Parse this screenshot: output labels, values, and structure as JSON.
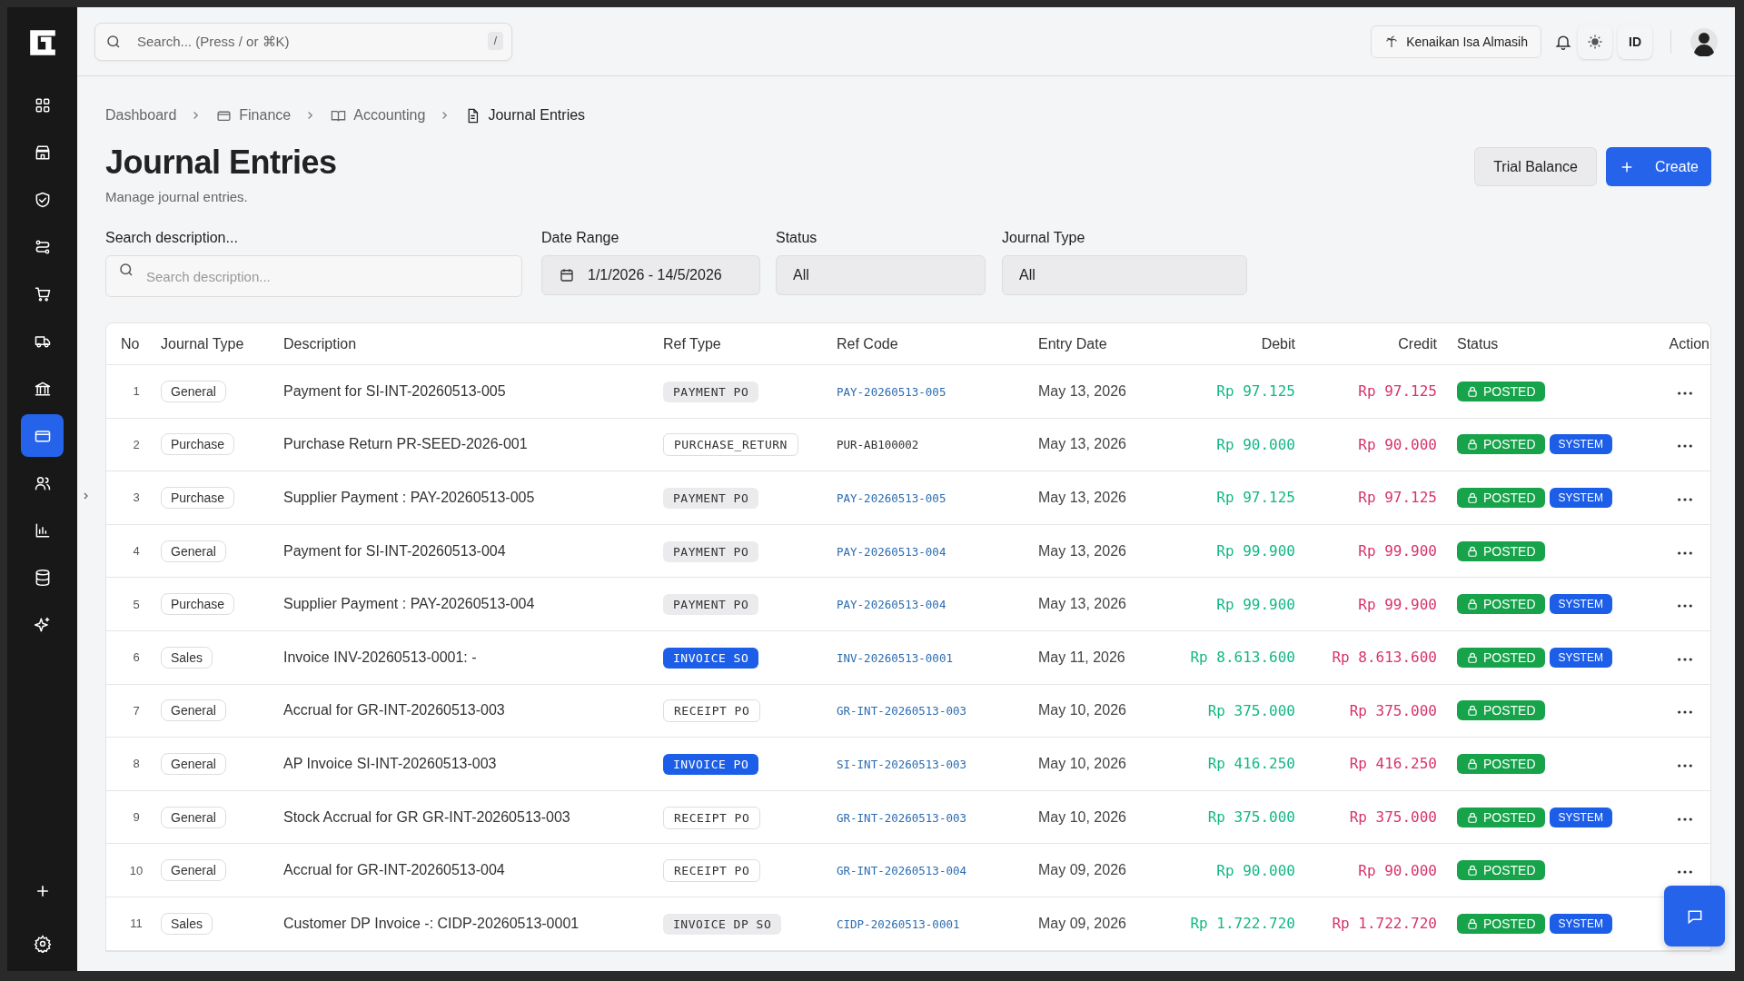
{
  "sidebar": {
    "items": [
      {
        "selected": false
      },
      {
        "selected": false
      },
      {
        "selected": false
      },
      {
        "selected": false
      },
      {
        "selected": false
      },
      {
        "selected": false
      },
      {
        "selected": false
      },
      {
        "selected": true
      },
      {
        "selected": false
      },
      {
        "selected": false
      },
      {
        "selected": false
      },
      {
        "selected": false
      }
    ]
  },
  "topbar": {
    "search": {
      "placeholder": "Search... (Press / or ⌘K)",
      "shortcut": "/"
    },
    "holiday": "Kenaikan Isa Almasih",
    "language": "ID"
  },
  "breadcrumb": [
    "Dashboard",
    "Finance",
    "Accounting",
    "Journal Entries"
  ],
  "page": {
    "title": "Journal Entries",
    "subtitle": "Manage journal entries.",
    "buttons": {
      "secondary": "Trial Balance",
      "primary": "Create"
    }
  },
  "filters": {
    "search": {
      "label": "Search description...",
      "placeholder": "Search description..."
    },
    "date_range": {
      "label": "Date Range",
      "value": "1/1/2026 - 14/5/2026"
    },
    "status": {
      "label": "Status",
      "value": "All"
    },
    "journal_type": {
      "label": "Journal Type",
      "value": "All"
    }
  },
  "table": {
    "columns": [
      "No",
      "Journal Type",
      "Description",
      "Ref Type",
      "Ref Code",
      "Entry Date",
      "Debit",
      "Credit",
      "Status",
      "Action"
    ],
    "rows": [
      {
        "no": "1",
        "journal_type": "General",
        "description": "Payment for SI-INT-20260513-005",
        "ref_type": {
          "label": "PAYMENT PO",
          "kind": "soft"
        },
        "ref_code": "PAY-20260513-005",
        "linked": true,
        "entry_date": "May 13, 2026",
        "debit": "Rp 97.125",
        "credit": "Rp 97.125",
        "status": "POSTED",
        "system": null,
        "menu": true
      },
      {
        "no": "2",
        "journal_type": "Purchase",
        "description": "Purchase Return PR-SEED-2026-001",
        "ref_type": {
          "label": "PURCHASE_RETURN",
          "kind": "outline"
        },
        "ref_code": "PUR-AB100002",
        "linked": false,
        "entry_date": "May 13, 2026",
        "debit": "Rp 90.000",
        "credit": "Rp 90.000",
        "status": "POSTED",
        "system": "SYSTEM",
        "menu": true
      },
      {
        "no": "3",
        "journal_type": "Purchase",
        "description": "Supplier Payment : PAY-20260513-005",
        "ref_type": {
          "label": "PAYMENT PO",
          "kind": "soft"
        },
        "ref_code": "PAY-20260513-005",
        "linked": true,
        "entry_date": "May 13, 2026",
        "debit": "Rp 97.125",
        "credit": "Rp 97.125",
        "status": "POSTED",
        "system": "SYSTEM",
        "menu": true
      },
      {
        "no": "4",
        "journal_type": "General",
        "description": "Payment for SI-INT-20260513-004",
        "ref_type": {
          "label": "PAYMENT PO",
          "kind": "soft"
        },
        "ref_code": "PAY-20260513-004",
        "linked": true,
        "entry_date": "May 13, 2026",
        "debit": "Rp 99.900",
        "credit": "Rp 99.900",
        "status": "POSTED",
        "system": null,
        "menu": true
      },
      {
        "no": "5",
        "journal_type": "Purchase",
        "description": "Supplier Payment : PAY-20260513-004",
        "ref_type": {
          "label": "PAYMENT PO",
          "kind": "soft"
        },
        "ref_code": "PAY-20260513-004",
        "linked": true,
        "entry_date": "May 13, 2026",
        "debit": "Rp 99.900",
        "credit": "Rp 99.900",
        "status": "POSTED",
        "system": "SYSTEM",
        "menu": true
      },
      {
        "no": "6",
        "journal_type": "Sales",
        "description": "Invoice INV-20260513-0001: -",
        "ref_type": {
          "label": "INVOICE SO",
          "kind": "solid"
        },
        "ref_code": "INV-20260513-0001",
        "linked": true,
        "entry_date": "May 11, 2026",
        "debit": "Rp 8.613.600",
        "credit": "Rp 8.613.600",
        "status": "POSTED",
        "system": "SYSTEM",
        "menu": true
      },
      {
        "no": "7",
        "journal_type": "General",
        "description": "Accrual for GR-INT-20260513-003",
        "ref_type": {
          "label": "RECEIPT PO",
          "kind": "outline"
        },
        "ref_code": "GR-INT-20260513-003",
        "linked": true,
        "entry_date": "May 10, 2026",
        "debit": "Rp 375.000",
        "credit": "Rp 375.000",
        "status": "POSTED",
        "system": null,
        "menu": true
      },
      {
        "no": "8",
        "journal_type": "General",
        "description": "AP Invoice SI-INT-20260513-003",
        "ref_type": {
          "label": "INVOICE PO",
          "kind": "solid"
        },
        "ref_code": "SI-INT-20260513-003",
        "linked": true,
        "entry_date": "May 10, 2026",
        "debit": "Rp 416.250",
        "credit": "Rp 416.250",
        "status": "POSTED",
        "system": null,
        "menu": true
      },
      {
        "no": "9",
        "journal_type": "General",
        "description": "Stock Accrual for GR GR-INT-20260513-003",
        "ref_type": {
          "label": "RECEIPT PO",
          "kind": "outline"
        },
        "ref_code": "GR-INT-20260513-003",
        "linked": true,
        "entry_date": "May 10, 2026",
        "debit": "Rp 375.000",
        "credit": "Rp 375.000",
        "status": "POSTED",
        "system": "SYSTEM",
        "menu": true
      },
      {
        "no": "10",
        "journal_type": "General",
        "description": "Accrual for GR-INT-20260513-004",
        "ref_type": {
          "label": "RECEIPT PO",
          "kind": "outline"
        },
        "ref_code": "GR-INT-20260513-004",
        "linked": true,
        "entry_date": "May 09, 2026",
        "debit": "Rp 90.000",
        "credit": "Rp 90.000",
        "status": "POSTED",
        "system": null,
        "menu": true
      },
      {
        "no": "11",
        "journal_type": "Sales",
        "description": "Customer DP Invoice -: CIDP-20260513-0001",
        "ref_type": {
          "label": "INVOICE DP SO",
          "kind": "soft"
        },
        "ref_code": "CIDP-20260513-0001",
        "linked": true,
        "entry_date": "May 09, 2026",
        "debit": "Rp 1.722.720",
        "credit": "Rp 1.722.720",
        "status": "POSTED",
        "system": "SYSTEM",
        "menu": false
      }
    ]
  }
}
